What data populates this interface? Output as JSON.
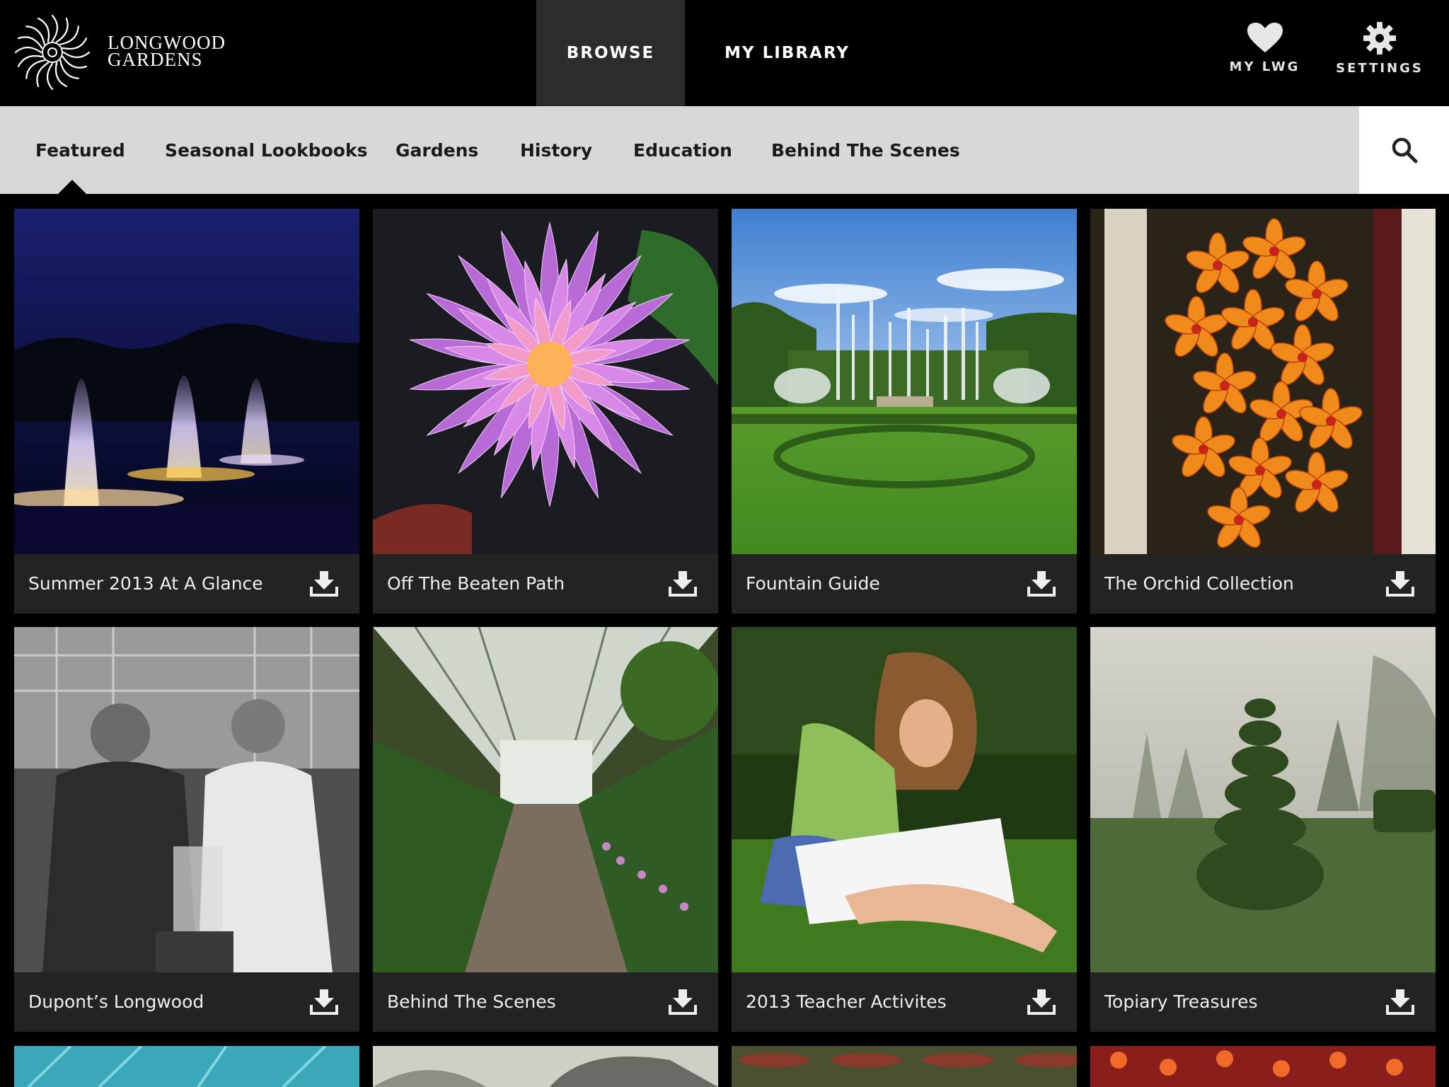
{
  "app": {
    "brand_line1": "LONGWOOD",
    "brand_line2": "GARDENS"
  },
  "nav": {
    "tabs": [
      {
        "label": "BROWSE",
        "active": true
      },
      {
        "label": "MY LIBRARY",
        "active": false
      }
    ],
    "icons": [
      {
        "label": "MY LWG",
        "icon": "heart-icon"
      },
      {
        "label": "SETTINGS",
        "icon": "gear-icon"
      }
    ]
  },
  "categories": {
    "items": [
      {
        "label": "Featured",
        "active": true
      },
      {
        "label": "Seasonal Lookbooks",
        "active": false
      },
      {
        "label": "Gardens",
        "active": false
      },
      {
        "label": "History",
        "active": false
      },
      {
        "label": "Education",
        "active": false
      },
      {
        "label": "Behind The Scenes",
        "active": false
      }
    ],
    "search_icon": "search-icon"
  },
  "cards": [
    {
      "title": "Summer 2013 At A Glance",
      "image": "illuminated-fountains-night",
      "action_icon": "download-icon"
    },
    {
      "title": "Off The Beaten Path",
      "image": "pink-water-lily",
      "action_icon": "download-icon"
    },
    {
      "title": "Fountain Guide",
      "image": "formal-garden-fountains",
      "action_icon": "download-icon"
    },
    {
      "title": "The Orchid Collection",
      "image": "orange-orchids",
      "action_icon": "download-icon"
    },
    {
      "title": "Dupont’s Longwood",
      "image": "vintage-photo-two-men",
      "action_icon": "download-icon"
    },
    {
      "title": "Behind The Scenes",
      "image": "greenhouse-aisle",
      "action_icon": "download-icon"
    },
    {
      "title": "2013 Teacher Activites",
      "image": "girl-writing-on-grass",
      "action_icon": "download-icon"
    },
    {
      "title": "Topiary Treasures",
      "image": "topiary-garden-fog",
      "action_icon": "download-icon"
    }
  ],
  "colors": {
    "background": "#000000",
    "active_tab": "#2c2c2c",
    "category_bar": "#d8d8d8",
    "card_footer": "#232323"
  }
}
